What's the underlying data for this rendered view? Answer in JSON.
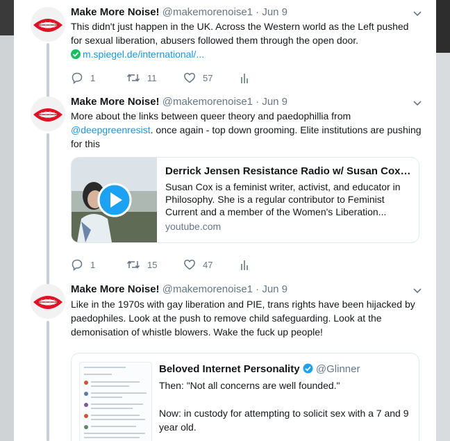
{
  "colors": {
    "accent": "#1b95e0",
    "muted": "#657786",
    "text": "#14171a",
    "verified": "#1da1f2",
    "lips": "#e01225"
  },
  "tweets": [
    {
      "name": "Make More Noise!",
      "handle": "@makemorenoise1 · Jun 9",
      "text": "This didn't just happen in the UK. Across the Western world as the Left pushed for sexual liberation, abusers followed them through the open door.",
      "link": "m.spiegel.de/international/...",
      "replies": "1",
      "retweets": "11",
      "likes": "57"
    },
    {
      "name": "Make More Noise!",
      "handle": "@makemorenoise1 · Jun 9",
      "text_before": "More about the links between queer theory and paedophillia from ",
      "mention": "@deepgreenresist",
      "text_after": ". once again - top down grooming. Elite institutions are pushing for this",
      "card": {
        "title": "Derrick Jensen Resistance Radio w/ Susan Cox - J...",
        "description": "Susan Cox is a feminist writer, activist, and educator in Philosophy. She is a regular contributor to Feminist Current and a member of the Women's Liberation...",
        "domain": "youtube.com",
        "icon": "play-icon"
      },
      "replies": "1",
      "retweets": "15",
      "likes": "47"
    },
    {
      "name": "Make More Noise!",
      "handle": "@makemorenoise1 · Jun 9",
      "text": "Like in the 1970s with gay liberation and PIE, trans rights have been hijacked by paedophiles. Look at the push to remove child safeguarding. Look at the demonisation of whistle blowers. Wake the fuck up people!",
      "quote": {
        "name": "Beloved Internet Personality",
        "handle": "@Glinner",
        "text_line1": "Then: \"Not all concerns are well founded.\"",
        "text_line2": "Now: in custody for attempting to solicit sex with a 7 and 9 year old."
      }
    }
  ]
}
